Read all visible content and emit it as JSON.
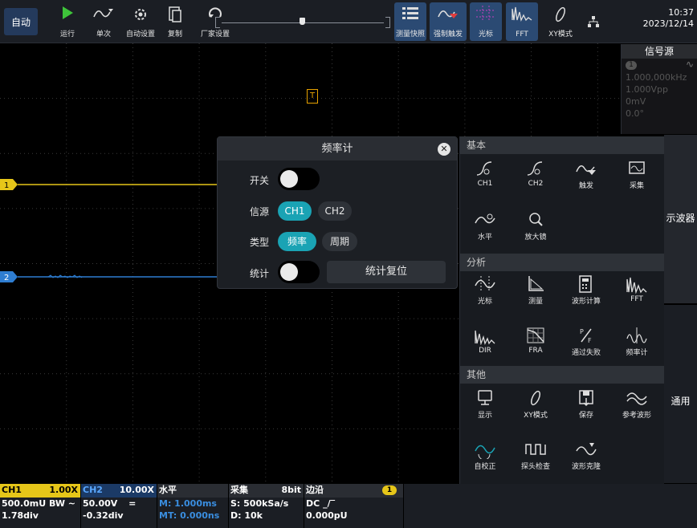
{
  "toolbar": {
    "mode": "自动",
    "buttons": [
      {
        "label": "运行",
        "icon": "play-icon"
      },
      {
        "label": "单次",
        "icon": "single-trigger-icon"
      },
      {
        "label": "自动设置",
        "icon": "auto-setup-icon"
      },
      {
        "label": "复制",
        "icon": "copy-icon"
      },
      {
        "label": "厂家设置",
        "icon": "factory-reset-icon"
      },
      {
        "label": "测量快照",
        "icon": "measure-snapshot-icon"
      },
      {
        "label": "强制触发",
        "icon": "force-trigger-icon"
      },
      {
        "label": "光标",
        "icon": "cursor-icon"
      },
      {
        "label": "FFT",
        "icon": "fft-icon"
      },
      {
        "label": "XY模式",
        "icon": "xy-mode-icon"
      }
    ],
    "time": "10:37",
    "date": "2023/12/14"
  },
  "colors": {
    "ch1": "#e6c619",
    "ch2": "#2e7dd1",
    "accent": "#1aa3b4",
    "trigger": "#e6a100"
  },
  "screen": {
    "trigger_marker": "T",
    "ch1_marker": "1",
    "ch2_marker": "2"
  },
  "signal_source": {
    "title": "信号源",
    "channel": "1",
    "frequency": "1.000,000kHz",
    "amplitude": "1.000Vpp",
    "offset": "0mV",
    "phase": "0.0°"
  },
  "freq_counter": {
    "title": "频率计",
    "switch_label": "开关",
    "source_label": "信源",
    "source_options": [
      "CH1",
      "CH2"
    ],
    "source_selected": "CH1",
    "type_label": "类型",
    "type_options": [
      "频率",
      "周期"
    ],
    "type_selected": "频率",
    "stats_label": "统计",
    "reset_label": "统计复位"
  },
  "menu": {
    "basic": {
      "title": "基本",
      "items": [
        "CH1",
        "CH2",
        "触发",
        "采集",
        "水平",
        "放大镜"
      ]
    },
    "analysis": {
      "title": "分析",
      "items": [
        "光标",
        "测量",
        "波形计算",
        "FFT",
        "DIR",
        "FRA",
        "通过失败",
        "频率计"
      ]
    },
    "other": {
      "title": "其他",
      "items": [
        "显示",
        "XY模式",
        "保存",
        "参考波形",
        "自校正",
        "探头检查",
        "波形克隆"
      ]
    }
  },
  "side_tabs": [
    "示波器",
    "通用"
  ],
  "status": {
    "ch1": {
      "name": "CH1",
      "probe": "1.00X",
      "scale": "500.0mU",
      "bw": "BW ~",
      "pos": "1.78div"
    },
    "ch2": {
      "name": "CH2",
      "probe": "10.00X",
      "scale": "50.00V",
      "coupling": "=",
      "pos": "-0.32div"
    },
    "horizontal": {
      "title": "水平",
      "main": "M: 1.000ms",
      "offset": "MT: 0.000ns"
    },
    "acquire": {
      "title": "采集",
      "bits": "8bit",
      "rate": "S: 500kSa/s",
      "depth": "D: 10k"
    },
    "trigger": {
      "title": "边沿",
      "source": "1",
      "coupling": "DC",
      "level": "0.000pU"
    }
  }
}
